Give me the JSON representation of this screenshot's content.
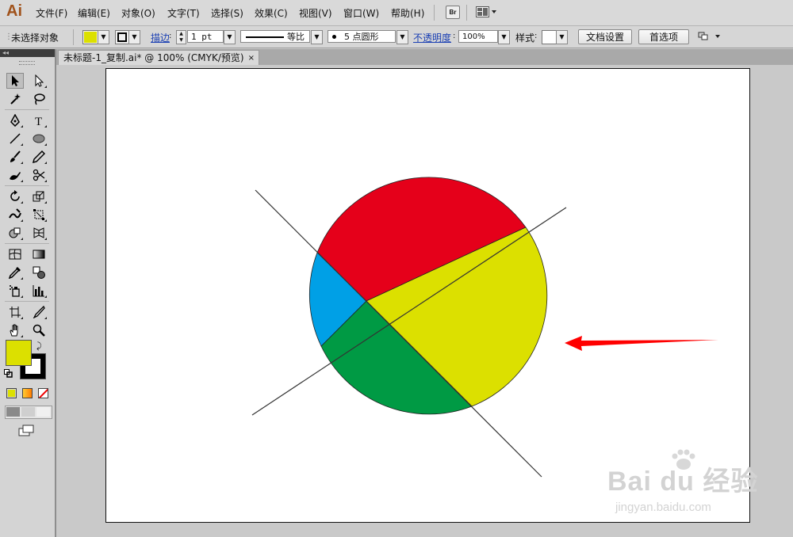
{
  "app": {
    "logo": "Ai",
    "menu": [
      "文件(F)",
      "编辑(E)",
      "对象(O)",
      "文字(T)",
      "选择(S)",
      "效果(C)",
      "视图(V)",
      "窗口(W)",
      "帮助(H)"
    ],
    "bridge_label": "Br"
  },
  "control_bar": {
    "selection_status": "未选择对象",
    "fill_color": "#dce000",
    "stroke_label": "描边",
    "stroke_weight": "1 pt",
    "stroke_profile": "等比",
    "brush": "5 点圆形",
    "opacity_label": "不透明度",
    "opacity": "100%",
    "style_label": "样式",
    "doc_setup_button": "文档设置",
    "preferences_button": "首选项"
  },
  "document": {
    "tab_title": "未标题-1_复制.ai* @ 100% (CMYK/预览)",
    "close_glyph": "×"
  },
  "tools": {
    "fill_color": "#dce000",
    "stroke_color": "#000000"
  },
  "artwork": {
    "colors": {
      "red": "#e5001a",
      "yellow": "#dce000",
      "green": "#009a44",
      "blue": "#00a0e6",
      "arrow": "#ff0000",
      "line": "#333333"
    }
  },
  "watermark": {
    "brand": "Bai du 经验",
    "url": "jingyan.baidu.com"
  }
}
